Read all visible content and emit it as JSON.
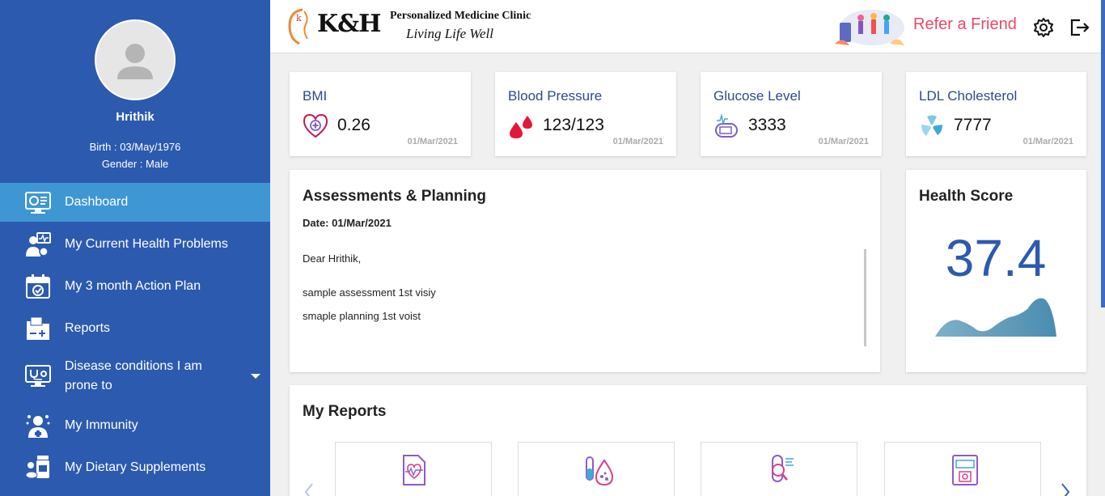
{
  "user": {
    "name": "Hrithik",
    "birth": "Birth : 03/May/1976",
    "gender": "Gender : Male"
  },
  "nav": {
    "items": [
      {
        "label": "Dashboard",
        "icon": "monitor-dashboard-icon"
      },
      {
        "label": "My Current Health Problems",
        "icon": "doctor-patient-icon"
      },
      {
        "label": "My 3 month Action Plan",
        "icon": "calendar-check-icon"
      },
      {
        "label": "Reports",
        "icon": "folder-medical-icon"
      },
      {
        "label": "Disease conditions I am",
        "label2": "prone to",
        "icon": "monitor-stethoscope-icon"
      },
      {
        "label": "My Immunity",
        "icon": "immune-person-icon"
      },
      {
        "label": "My Dietary Supplements",
        "icon": "pills-bottle-icon"
      }
    ]
  },
  "header": {
    "logo": "K&H",
    "clinic": "Personalized Medicine Clinic",
    "tagline": "Living Life Well",
    "refer": "Refer a Friend"
  },
  "vitals": [
    {
      "title": "BMI",
      "value": "0.26",
      "date": "01/Mar/2021",
      "icon": "heart-plus-icon"
    },
    {
      "title": "Blood Pressure",
      "value": "123/123",
      "date": "01/Mar/2021",
      "icon": "blood-drops-icon"
    },
    {
      "title": "Glucose Level",
      "value": "3333",
      "date": "01/Mar/2021",
      "icon": "glucose-meter-icon"
    },
    {
      "title": "LDL Cholesterol",
      "value": "7777",
      "date": "01/Mar/2021",
      "icon": "cholesterol-fan-icon"
    }
  ],
  "assessment": {
    "title": "Assessments & Planning",
    "date": "Date: 01/Mar/2021",
    "greeting": "Dear Hrithik,",
    "line1": "sample assessment 1st visiy",
    "line2": "smaple planning 1st voist"
  },
  "health_score": {
    "title": "Health Score",
    "value": "37.4"
  },
  "reports": {
    "title": "My Reports",
    "tiles": [
      {
        "icon": "ecg-report-icon"
      },
      {
        "icon": "blood-test-icon"
      },
      {
        "icon": "test-tube-search-icon"
      },
      {
        "icon": "bmp-report-icon"
      }
    ]
  },
  "colors": {
    "sidebar": "#2c5aae",
    "active_nav": "#3e97d3",
    "accent_pink": "#e84a66",
    "score_blue": "#2c5aae"
  }
}
